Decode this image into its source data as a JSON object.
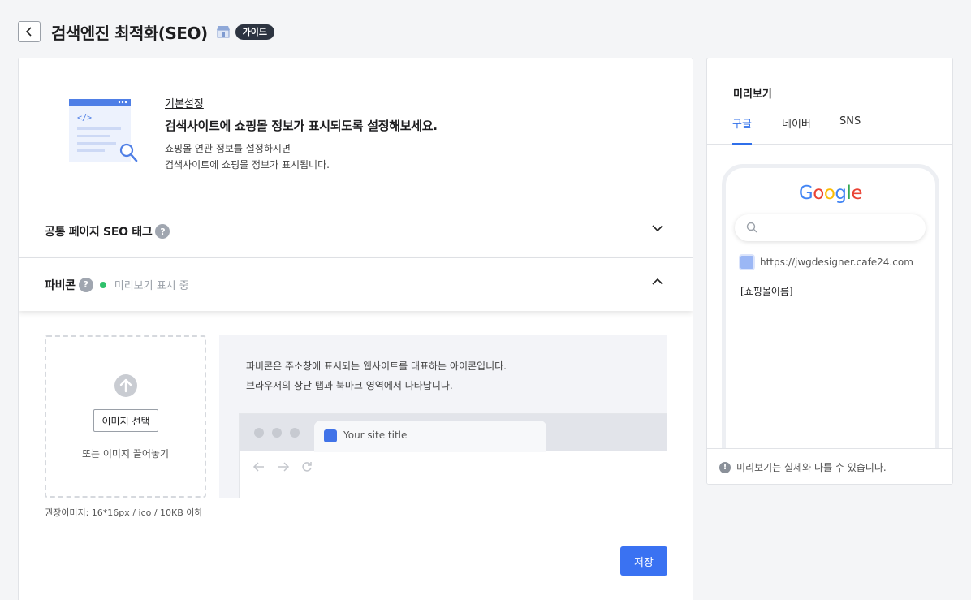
{
  "header": {
    "title": "검색엔진 최적화(SEO)",
    "guide_badge": "가이드"
  },
  "intro": {
    "label": "기본설정",
    "heading": "검색사이트에 쇼핑몰 정보가 표시되도록 설정해보세요.",
    "desc_line1": "쇼핑몰 연관 정보를 설정하시면",
    "desc_line2": "검색사이트에 쇼핑몰 정보가 표시됩니다."
  },
  "sections": {
    "common_tag": {
      "title": "공통 페이지 SEO 태그",
      "help": "?"
    },
    "favicon": {
      "title": "파비콘",
      "help": "?",
      "status": "미리보기 표시 중"
    }
  },
  "upload": {
    "select_button": "이미지 선택",
    "drag_text": "또는 이미지 끌어놓기",
    "recommend": "권장이미지: 16*16px / ico / 10KB 이하"
  },
  "favicon_info": {
    "line1": "파비콘은 주소창에 표시되는 웹사이트를 대표하는 아이콘입니다.",
    "line2": "브라우저의 상단 탭과 북마크 영역에서 나타납니다.",
    "tab_title": "Your site title"
  },
  "save_button": "저장",
  "preview": {
    "title": "미리보기",
    "tabs": [
      "구글",
      "네이버",
      "SNS"
    ],
    "active_tab": "구글",
    "google_letters": [
      "G",
      "o",
      "o",
      "g",
      "l",
      "e"
    ],
    "google_colors": [
      "#4285F4",
      "#EA4335",
      "#FBBC05",
      "#4285F4",
      "#34A853",
      "#EA4335"
    ],
    "result_url": "https://jwgdesigner.cafe24.com",
    "result_title": "[쇼핑몰이름]",
    "footer_info": "!",
    "footer_text": "미리보기는 실제와 다를 수 있습니다."
  },
  "colors": {
    "accent": "#3a72f2",
    "status_green": "#2fc16b",
    "badge_dark": "#2d3441"
  }
}
